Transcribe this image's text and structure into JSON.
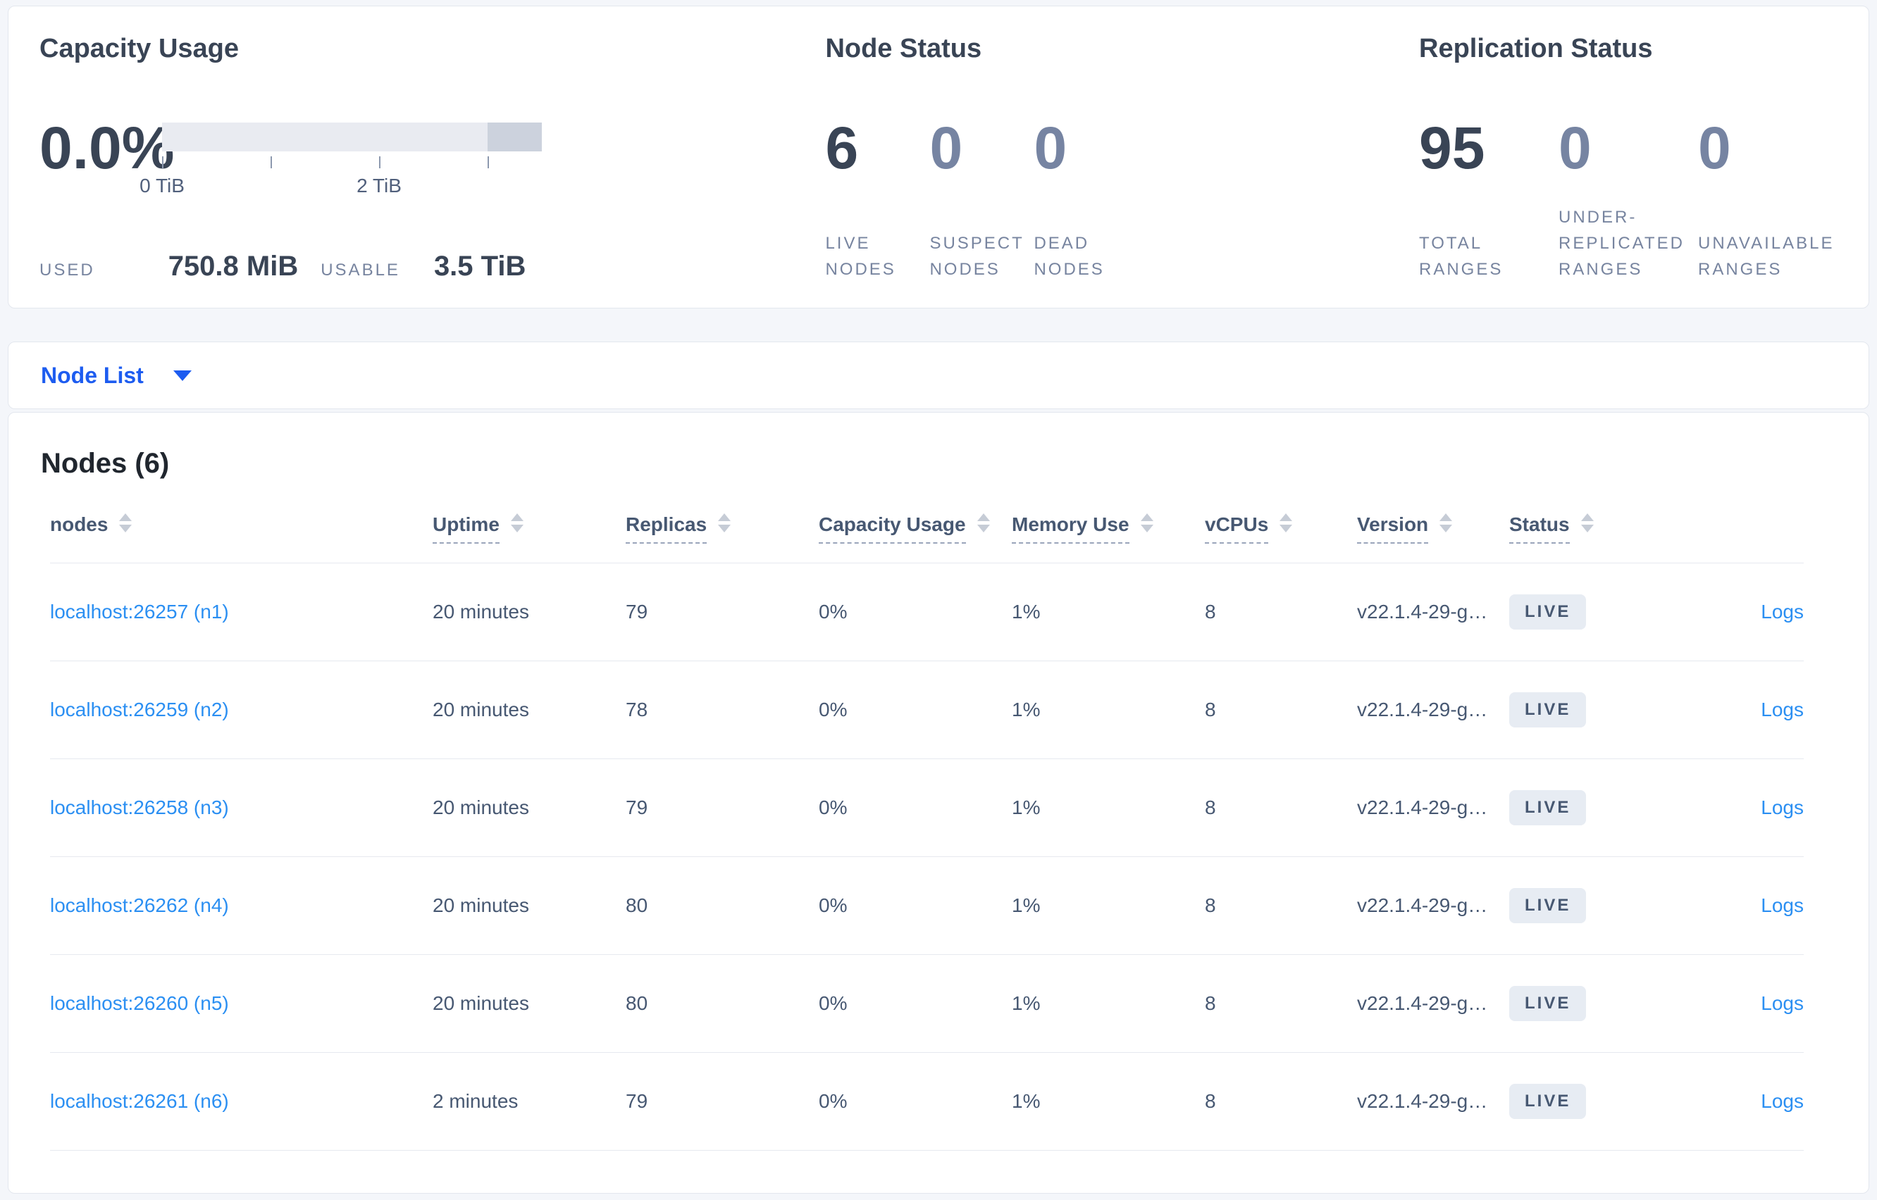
{
  "colors": {
    "page_bg": "#f4f6fa",
    "accent_blue": "#1d5cf0",
    "link_blue": "#2b8ff2",
    "text_dark": "#394455",
    "text_slate": "#475872",
    "text_muted": "#77849f",
    "badge_bg": "#e7ecf3",
    "bar_track": "#e9ebf1",
    "bar_dark_segment": "#ccd2dd"
  },
  "summary": {
    "capacity": {
      "title": "Capacity Usage",
      "percent": "0.0%",
      "axis_tick_labels": [
        "0 TiB",
        "2 TiB"
      ],
      "axis_tick_positions_pct": [
        0,
        28.57,
        57.14,
        85.71
      ],
      "dark_segment_start_pct": 85.71,
      "used_label": "USED",
      "used_value": "750.8 MiB",
      "usable_label": "USABLE",
      "usable_value": "3.5 TiB"
    },
    "node_status": {
      "title": "Node Status",
      "stats": [
        {
          "value": "6",
          "label": "LIVE NODES",
          "muted": false
        },
        {
          "value": "0",
          "label": "SUSPECT NODES",
          "muted": true
        },
        {
          "value": "0",
          "label": "DEAD NODES",
          "muted": true
        }
      ]
    },
    "replication_status": {
      "title": "Replication Status",
      "stats": [
        {
          "value": "95",
          "label": "TOTAL RANGES",
          "muted": false
        },
        {
          "value": "0",
          "label": "UNDER-REPLICATED RANGES",
          "muted": true
        },
        {
          "value": "0",
          "label": "UNAVAILABLE RANGES",
          "muted": true
        }
      ]
    }
  },
  "view_selector": {
    "label": "Node List"
  },
  "nodes": {
    "title": "Nodes (6)",
    "columns": [
      "nodes",
      "Uptime",
      "Replicas",
      "Capacity Usage",
      "Memory Use",
      "vCPUs",
      "Version",
      "Status"
    ],
    "logs_label": "Logs",
    "rows": [
      {
        "node": "localhost:26257 (n1)",
        "uptime": "20 minutes",
        "replicas": "79",
        "capacity": "0%",
        "memory": "1%",
        "vcpus": "8",
        "version": "v22.1.4-29-g…",
        "status": "LIVE",
        "logs": "Logs"
      },
      {
        "node": "localhost:26259 (n2)",
        "uptime": "20 minutes",
        "replicas": "78",
        "capacity": "0%",
        "memory": "1%",
        "vcpus": "8",
        "version": "v22.1.4-29-g…",
        "status": "LIVE",
        "logs": "Logs"
      },
      {
        "node": "localhost:26258 (n3)",
        "uptime": "20 minutes",
        "replicas": "79",
        "capacity": "0%",
        "memory": "1%",
        "vcpus": "8",
        "version": "v22.1.4-29-g…",
        "status": "LIVE",
        "logs": "Logs"
      },
      {
        "node": "localhost:26262 (n4)",
        "uptime": "20 minutes",
        "replicas": "80",
        "capacity": "0%",
        "memory": "1%",
        "vcpus": "8",
        "version": "v22.1.4-29-g…",
        "status": "LIVE",
        "logs": "Logs"
      },
      {
        "node": "localhost:26260 (n5)",
        "uptime": "20 minutes",
        "replicas": "80",
        "capacity": "0%",
        "memory": "1%",
        "vcpus": "8",
        "version": "v22.1.4-29-g…",
        "status": "LIVE",
        "logs": "Logs"
      },
      {
        "node": "localhost:26261 (n6)",
        "uptime": "2 minutes",
        "replicas": "79",
        "capacity": "0%",
        "memory": "1%",
        "vcpus": "8",
        "version": "v22.1.4-29-g…",
        "status": "LIVE",
        "logs": "Logs"
      }
    ]
  }
}
